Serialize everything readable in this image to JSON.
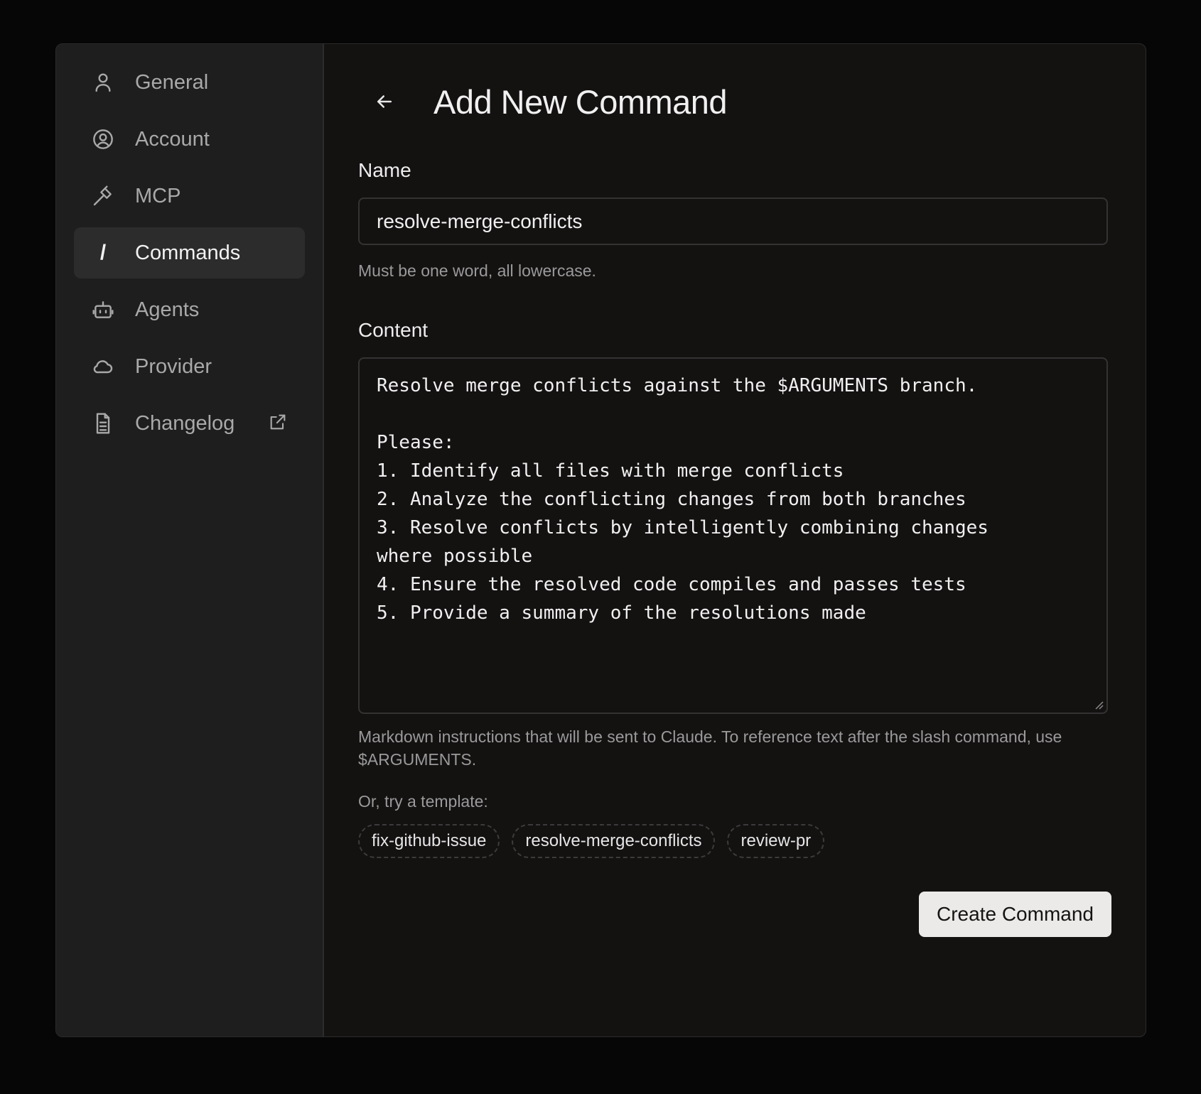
{
  "sidebar": {
    "items": [
      {
        "label": "General",
        "icon": "user-icon",
        "active": false
      },
      {
        "label": "Account",
        "icon": "user-circle-icon",
        "active": false
      },
      {
        "label": "MCP",
        "icon": "hammer-icon",
        "active": false
      },
      {
        "label": "Commands",
        "icon": "slash-icon",
        "active": true
      },
      {
        "label": "Agents",
        "icon": "robot-icon",
        "active": false
      },
      {
        "label": "Provider",
        "icon": "cloud-icon",
        "active": false
      },
      {
        "label": "Changelog",
        "icon": "document-icon",
        "active": false,
        "external": true
      }
    ],
    "commands_glyph": "/"
  },
  "header": {
    "title": "Add New Command",
    "back_icon": "arrow-left-icon"
  },
  "form": {
    "name_label": "Name",
    "name_value": "resolve-merge-conflicts",
    "name_hint": "Must be one word, all lowercase.",
    "content_label": "Content",
    "content_lines": [
      "Resolve merge conflicts against the $ARGUMENTS branch.",
      "",
      "Please:",
      "1. Identify all files with merge conflicts",
      "2. Analyze the conflicting changes from both branches",
      "3. Resolve conflicts by intelligently combining changes",
      "where possible",
      "4. Ensure the resolved code compiles and passes tests",
      "5. Provide a summary of the resolutions made"
    ],
    "content_hint": "Markdown instructions that will be sent to Claude. To reference text after the slash command, use $ARGUMENTS.",
    "template_label": "Or, try a template:",
    "templates": [
      "fix-github-issue",
      "resolve-merge-conflicts",
      "review-pr"
    ],
    "submit_label": "Create Command"
  },
  "colors": {
    "background": "#141111",
    "sidebar": "#1e1e1e",
    "active_item": "#2c2c2c",
    "primary_button": "#ebeae8"
  }
}
